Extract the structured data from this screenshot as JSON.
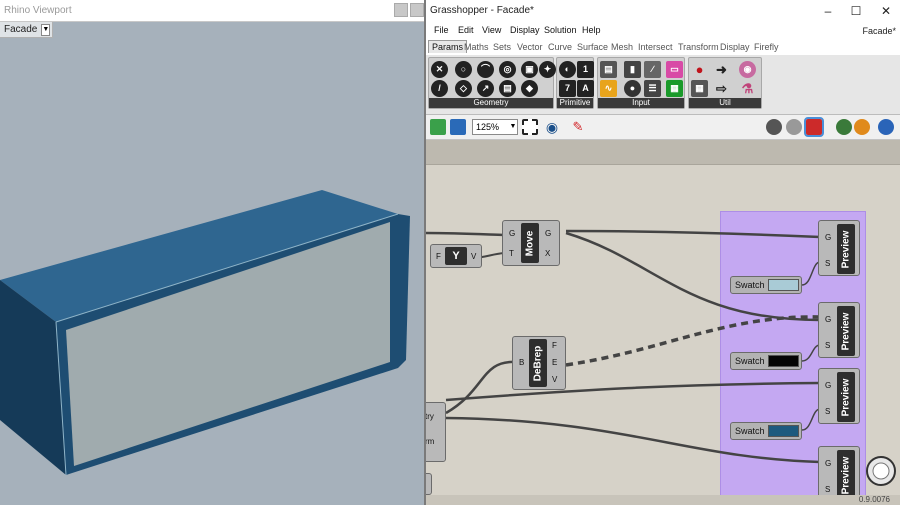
{
  "rhino": {
    "title": "Rhino Viewport",
    "viewport_name": "Facade"
  },
  "grasshopper": {
    "title": "Grasshopper - Facade*",
    "window_controls": {
      "minimize": "–",
      "maximize": "☐",
      "close": "✕"
    },
    "menu": [
      "File",
      "Edit",
      "View",
      "Display",
      "Solution",
      "Help"
    ],
    "document_name": "Facade*",
    "tabs": [
      "Params",
      "Maths",
      "Sets",
      "Vector",
      "Curve",
      "Surface",
      "Mesh",
      "Intersect",
      "Transform",
      "Display",
      "Firefly"
    ],
    "active_tab": "Params",
    "ribbon_panels": [
      "Geometry",
      "Primitive",
      "Input",
      "Util"
    ],
    "zoom": "125%",
    "status_value": "0.9.0076"
  },
  "canvas": {
    "components": {
      "move": {
        "name": "Move",
        "inputs": [
          "G",
          "T"
        ],
        "outputs": [
          "G",
          "X"
        ]
      },
      "vector_xyz": {
        "inputs": [
          "F"
        ],
        "outputs": [
          "V"
        ],
        "glyph": "Y"
      },
      "debrep": {
        "name": "DeBrep",
        "inputs": [
          "B"
        ],
        "outputs": [
          "F",
          "E",
          "V"
        ]
      },
      "param_geometry_label": "try",
      "param_form_label": "rm",
      "preview_name": "Preview",
      "preview_inputs": [
        "G",
        "S"
      ]
    },
    "swatches": [
      {
        "label": "Swatch",
        "color": "#a9cbd6"
      },
      {
        "label": "Swatch",
        "color": "#050505"
      },
      {
        "label": "Swatch",
        "color": "#1d5a7e"
      }
    ]
  },
  "colors": {
    "box_face": "#1e4d72",
    "box_glass": "#a0abae",
    "group_fill": "#c4a8f2",
    "canvas_bg": "#d6d2c8"
  }
}
